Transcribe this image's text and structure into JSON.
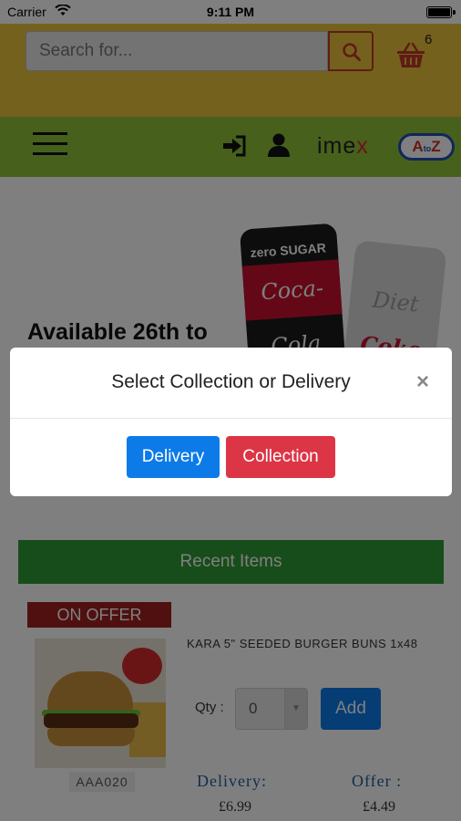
{
  "status_bar": {
    "carrier": "Carrier",
    "time": "9:11 PM"
  },
  "header": {
    "search_placeholder": "Search for...",
    "cart_count": "6",
    "brand_imex": "ime",
    "brand_imex_x": "x",
    "brand_atoz_a": "A",
    "brand_atoz_to": "to",
    "brand_atoz_z": "Z"
  },
  "banner": {
    "text": "Available 26th to",
    "can1_top": "zero SUGAR",
    "can1_label": "Coca-Cola",
    "can2_label_a": "Diet ",
    "can2_label_b": "Coke"
  },
  "modal": {
    "title": "Select Collection or Delivery",
    "close": "×",
    "delivery_label": "Delivery",
    "collection_label": "Collection"
  },
  "recent": {
    "heading": "Recent Items",
    "items": [
      {
        "badge": "ON OFFER",
        "name": "KARA 5\" SEEDED BURGER BUNS 1x48",
        "code": "AAA020",
        "qty_label": "Qty :",
        "qty_value": "0",
        "add_label": "Add",
        "delivery_label": "Delivery:",
        "delivery_price": "£6.99",
        "offer_label": "Offer :",
        "offer_price": "£4.49"
      }
    ]
  },
  "colors": {
    "topbar": "#e8c23a",
    "navbar": "#8fc33a",
    "recent_bar": "#2e9b35",
    "delivery_btn": "#0c7be8",
    "collection_btn": "#dc3545",
    "offer_badge": "#a02020"
  }
}
